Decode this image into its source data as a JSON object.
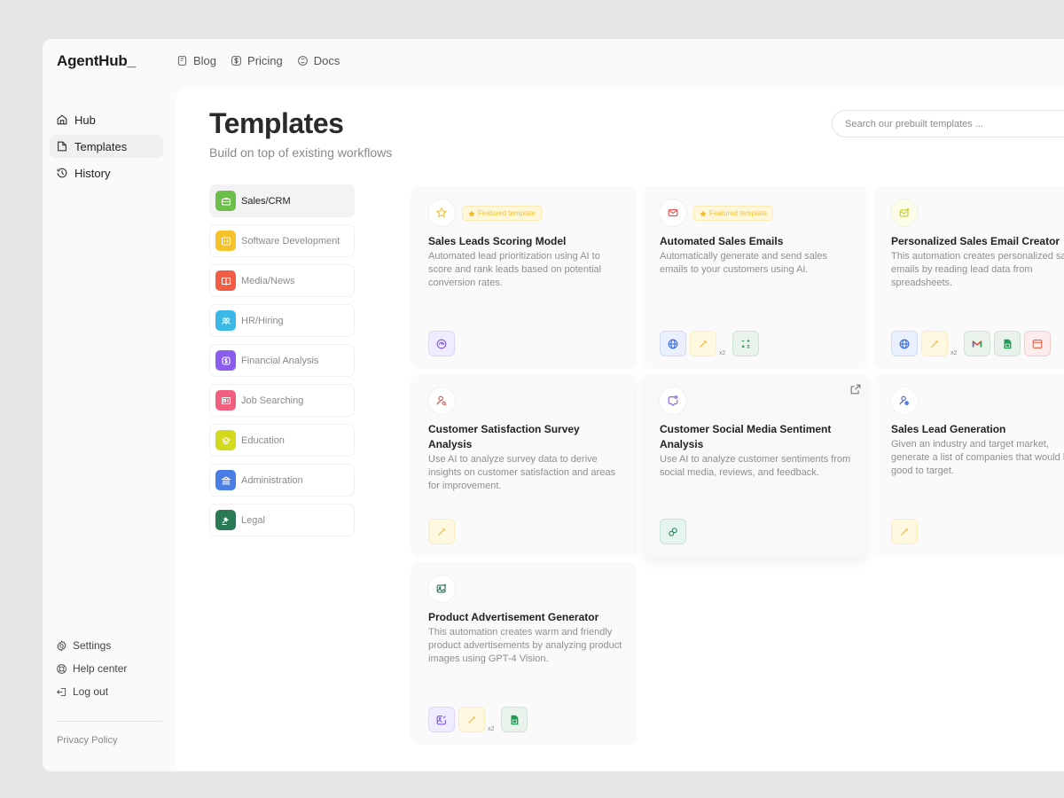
{
  "app": {
    "logo": "AgentHub_"
  },
  "topnav": [
    {
      "label": "Blog",
      "icon": "book-icon"
    },
    {
      "label": "Pricing",
      "icon": "dollar-icon"
    },
    {
      "label": "Docs",
      "icon": "docs-icon"
    }
  ],
  "sidebar": {
    "items": [
      {
        "label": "Hub",
        "icon": "home-icon",
        "active": false
      },
      {
        "label": "Templates",
        "icon": "folder-icon",
        "active": true
      },
      {
        "label": "History",
        "icon": "history-icon",
        "active": false
      }
    ],
    "bottom": [
      {
        "label": "Settings",
        "icon": "gear-icon"
      },
      {
        "label": "Help center",
        "icon": "lifebuoy-icon"
      },
      {
        "label": "Log out",
        "icon": "logout-icon"
      }
    ],
    "privacy": "Privacy Policy"
  },
  "header": {
    "title": "Templates",
    "subtitle": "Build on top of existing workflows",
    "search_placeholder": "Search our prebuilt templates ..."
  },
  "categories": [
    {
      "label": "Sales/CRM",
      "color": "#6cc04a",
      "active": true
    },
    {
      "label": "Software Development",
      "color": "#f5c22b",
      "active": false
    },
    {
      "label": "Media/News",
      "color": "#f25c45",
      "active": false
    },
    {
      "label": "HR/Hiring",
      "color": "#3cb8e6",
      "active": false
    },
    {
      "label": "Financial Analysis",
      "color": "#8c5cf0",
      "active": false
    },
    {
      "label": "Job Searching",
      "color": "#f0607e",
      "active": false
    },
    {
      "label": "Education",
      "color": "#d3d91c",
      "active": false
    },
    {
      "label": "Administration",
      "color": "#4a7de6",
      "active": false
    },
    {
      "label": "Legal",
      "color": "#2a7a55",
      "active": false
    }
  ],
  "featured_label": "Featured template",
  "cards": [
    {
      "title": "Sales Leads Scoring Model",
      "description": "Automated lead prioritization using AI to score and rank leads based on potential conversion rates.",
      "featured": true,
      "icon": "star-icon",
      "tools": [
        {
          "icon": "gauge-icon",
          "color": "purple"
        }
      ]
    },
    {
      "title": "Automated Sales Emails",
      "description": "Automatically generate and send sales emails to your customers using AI.",
      "featured": true,
      "icon": "mail-icon",
      "tools": [
        {
          "icon": "globe-icon",
          "color": "blue"
        },
        {
          "icon": "magic-wand-icon",
          "color": "yellow",
          "multiplier": "x2"
        },
        {
          "icon": "calculator-icon",
          "color": "green"
        }
      ]
    },
    {
      "title": "Personalized Sales Email Creator",
      "description": "This automation creates personalized sales emails by reading lead data from spreadsheets.",
      "featured": false,
      "icon": "mail-sparkle-icon",
      "tools": [
        {
          "icon": "globe-icon",
          "color": "blue"
        },
        {
          "icon": "magic-wand-icon",
          "color": "yellow",
          "multiplier": "x2"
        },
        {
          "icon": "gmail-icon",
          "color": "green"
        },
        {
          "icon": "sheets-icon",
          "color": "green"
        },
        {
          "icon": "window-icon",
          "color": "red"
        }
      ]
    },
    {
      "title": "Customer Satisfaction Survey Analysis",
      "description": "Use AI to analyze survey data to derive insights on customer satisfaction and areas for improvement.",
      "featured": false,
      "icon": "user-search-icon",
      "tools": [
        {
          "icon": "magic-wand-icon",
          "color": "yellow"
        }
      ]
    },
    {
      "title": "Customer Social Media Sentiment Analysis",
      "description": "Use AI to analyze customer sentiments from social media, reviews, and feedback.",
      "featured": false,
      "icon": "chat-bubble-icon",
      "tools": [
        {
          "icon": "link-icon",
          "color": "mint"
        }
      ]
    },
    {
      "title": "Sales Lead Generation",
      "description": "Given an industry and target market, generate a list of companies that would be good to target.",
      "featured": false,
      "icon": "user-target-icon",
      "tools": [
        {
          "icon": "magic-wand-icon",
          "color": "yellow"
        }
      ]
    },
    {
      "title": "Product Advertisement Generator",
      "description": "This automation creates warm and friendly product advertisements by analyzing product images using GPT-4 Vision.",
      "featured": false,
      "icon": "image-sparkle-icon",
      "tools": [
        {
          "icon": "image-edit-icon",
          "color": "purple"
        },
        {
          "icon": "magic-wand-icon",
          "color": "yellow",
          "multiplier": "x2"
        },
        {
          "icon": "sheets-icon",
          "color": "green"
        }
      ]
    }
  ]
}
